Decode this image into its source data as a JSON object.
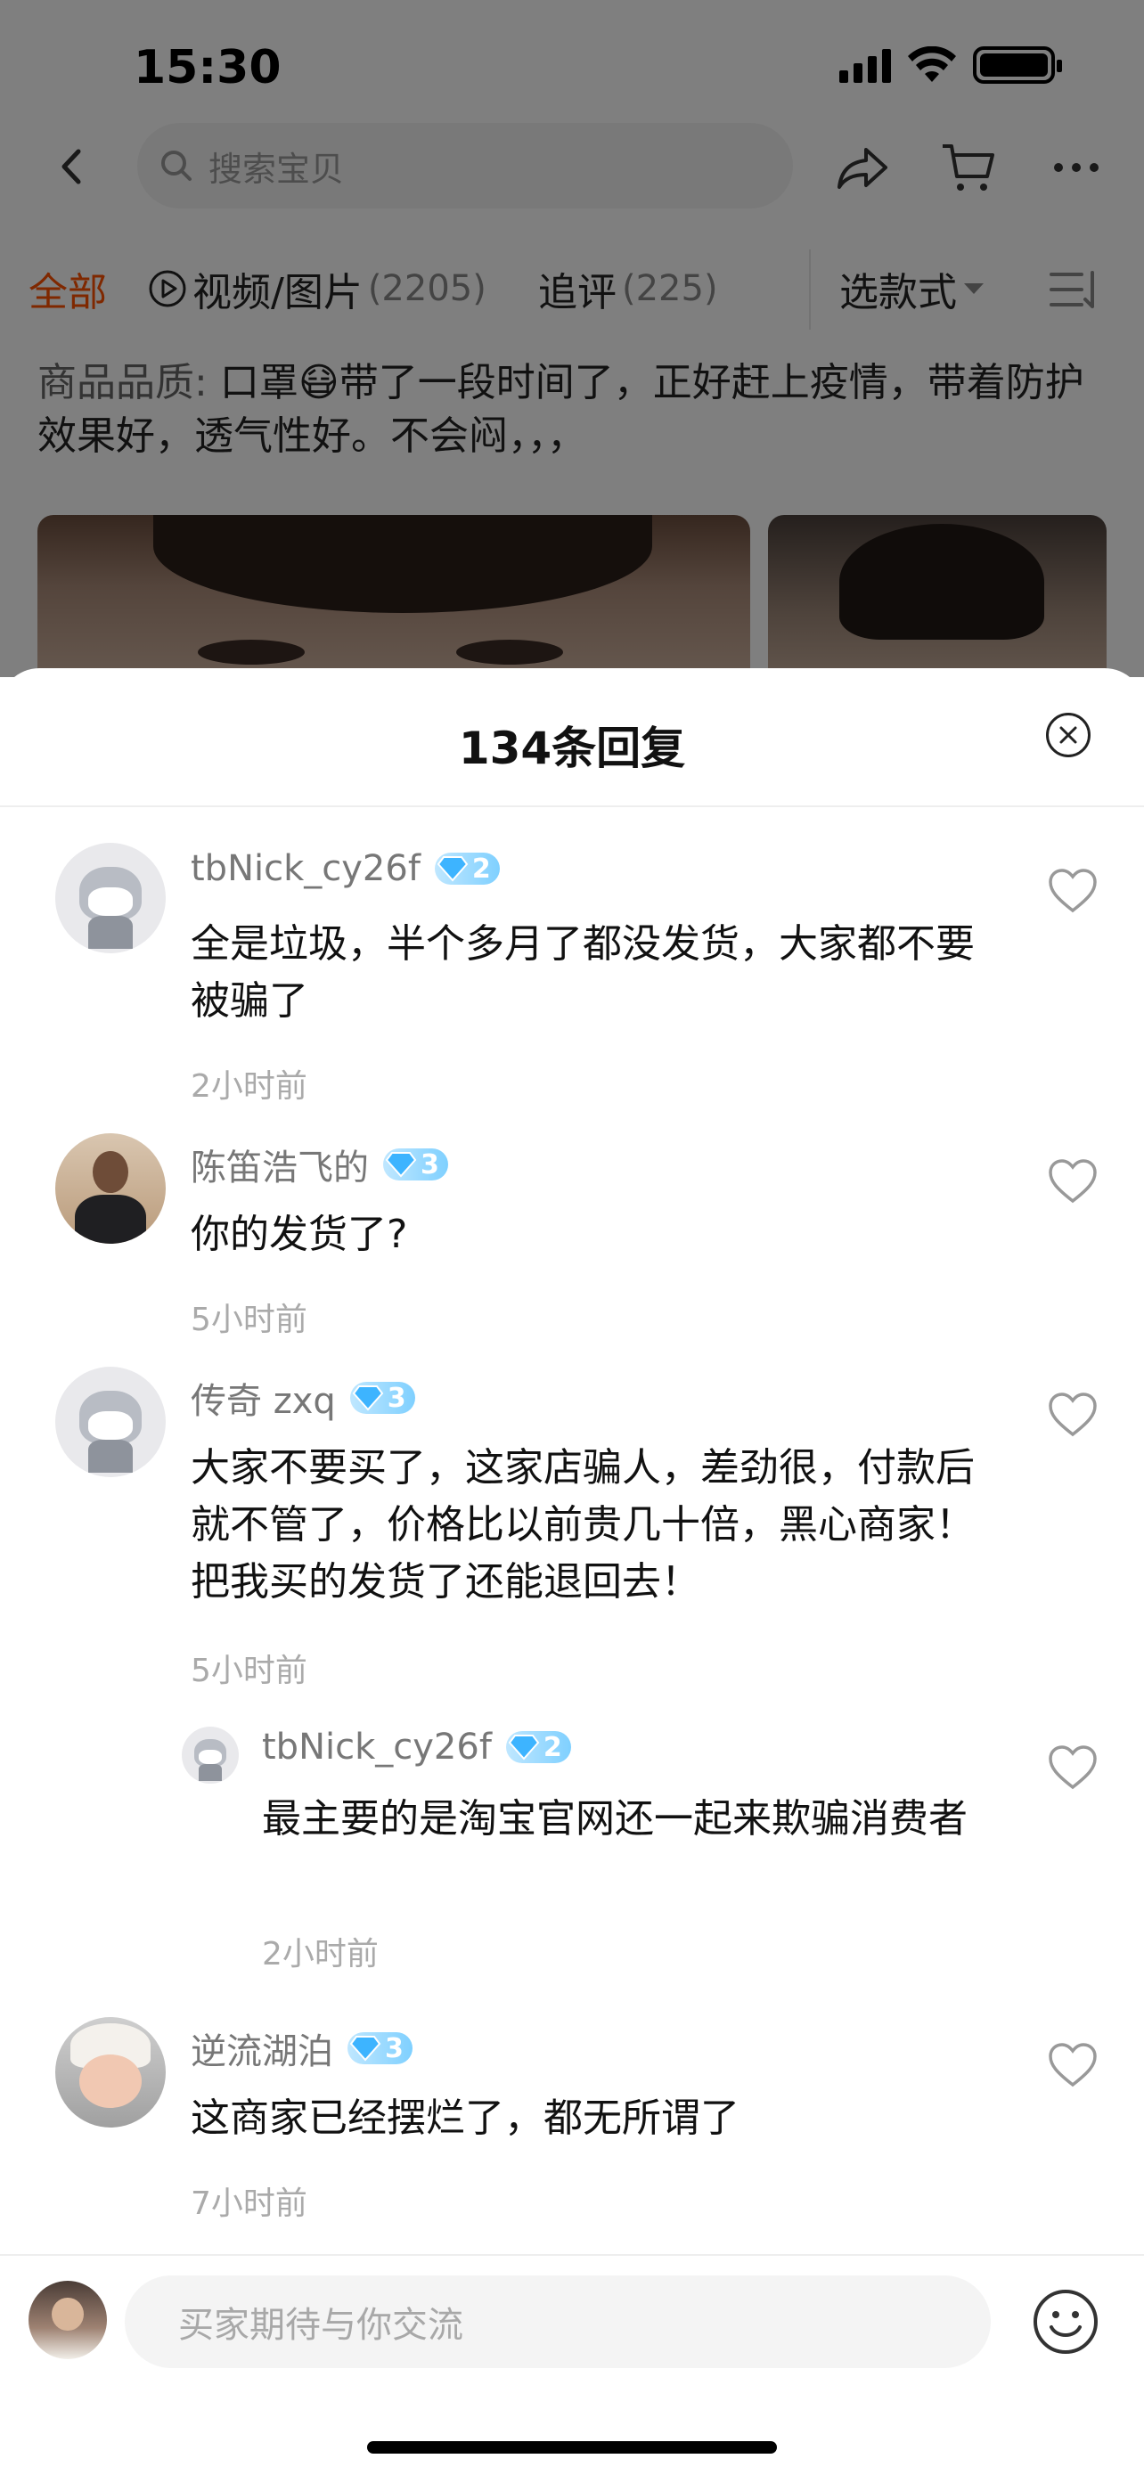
{
  "status_bar": {
    "time": "15:30"
  },
  "top_nav": {
    "search_placeholder": "搜索宝贝"
  },
  "tabs": [
    {
      "label": "全部",
      "count": ""
    },
    {
      "label": "视频/图片",
      "count": "(2205)"
    },
    {
      "label": "追评",
      "count": "(225)"
    },
    {
      "label": "选款式",
      "count": ""
    }
  ],
  "review": {
    "label": "商品品质:",
    "text": "口罩😷带了一段时间了，正好赶上疫情，带着防护效果好，透气性好。不会闷，，，"
  },
  "sheet": {
    "title": "134条回复",
    "comments": [
      {
        "user": "tbNick_cy26f",
        "level": "2",
        "text": "全是垃圾，半个多月了都没发货，大家都不要被骗了",
        "time": "2小时前"
      },
      {
        "user": "陈笛浩飞的",
        "level": "3",
        "text": "你的发货了?",
        "time": "5小时前"
      },
      {
        "user": "传奇 zxq",
        "level": "3",
        "text": "大家不要买了，这家店骗人，差劲很，付款后就不管了，价格比以前贵几十倍，黑心商家！把我买的发货了还能退回去！",
        "time": "5小时前"
      },
      {
        "user": "tbNick_cy26f",
        "level": "2",
        "text": "最主要的是淘宝官网还一起来欺骗消费者",
        "time": "2小时前"
      },
      {
        "user": "逆流湖泊",
        "level": "3",
        "text": "这商家已经摆烂了，都无所谓了",
        "time": "7小时前"
      }
    ]
  },
  "input_bar": {
    "placeholder": "买家期待与你交流"
  },
  "colors": {
    "accent": "#ff5000",
    "badge": "#7fd0ff"
  }
}
